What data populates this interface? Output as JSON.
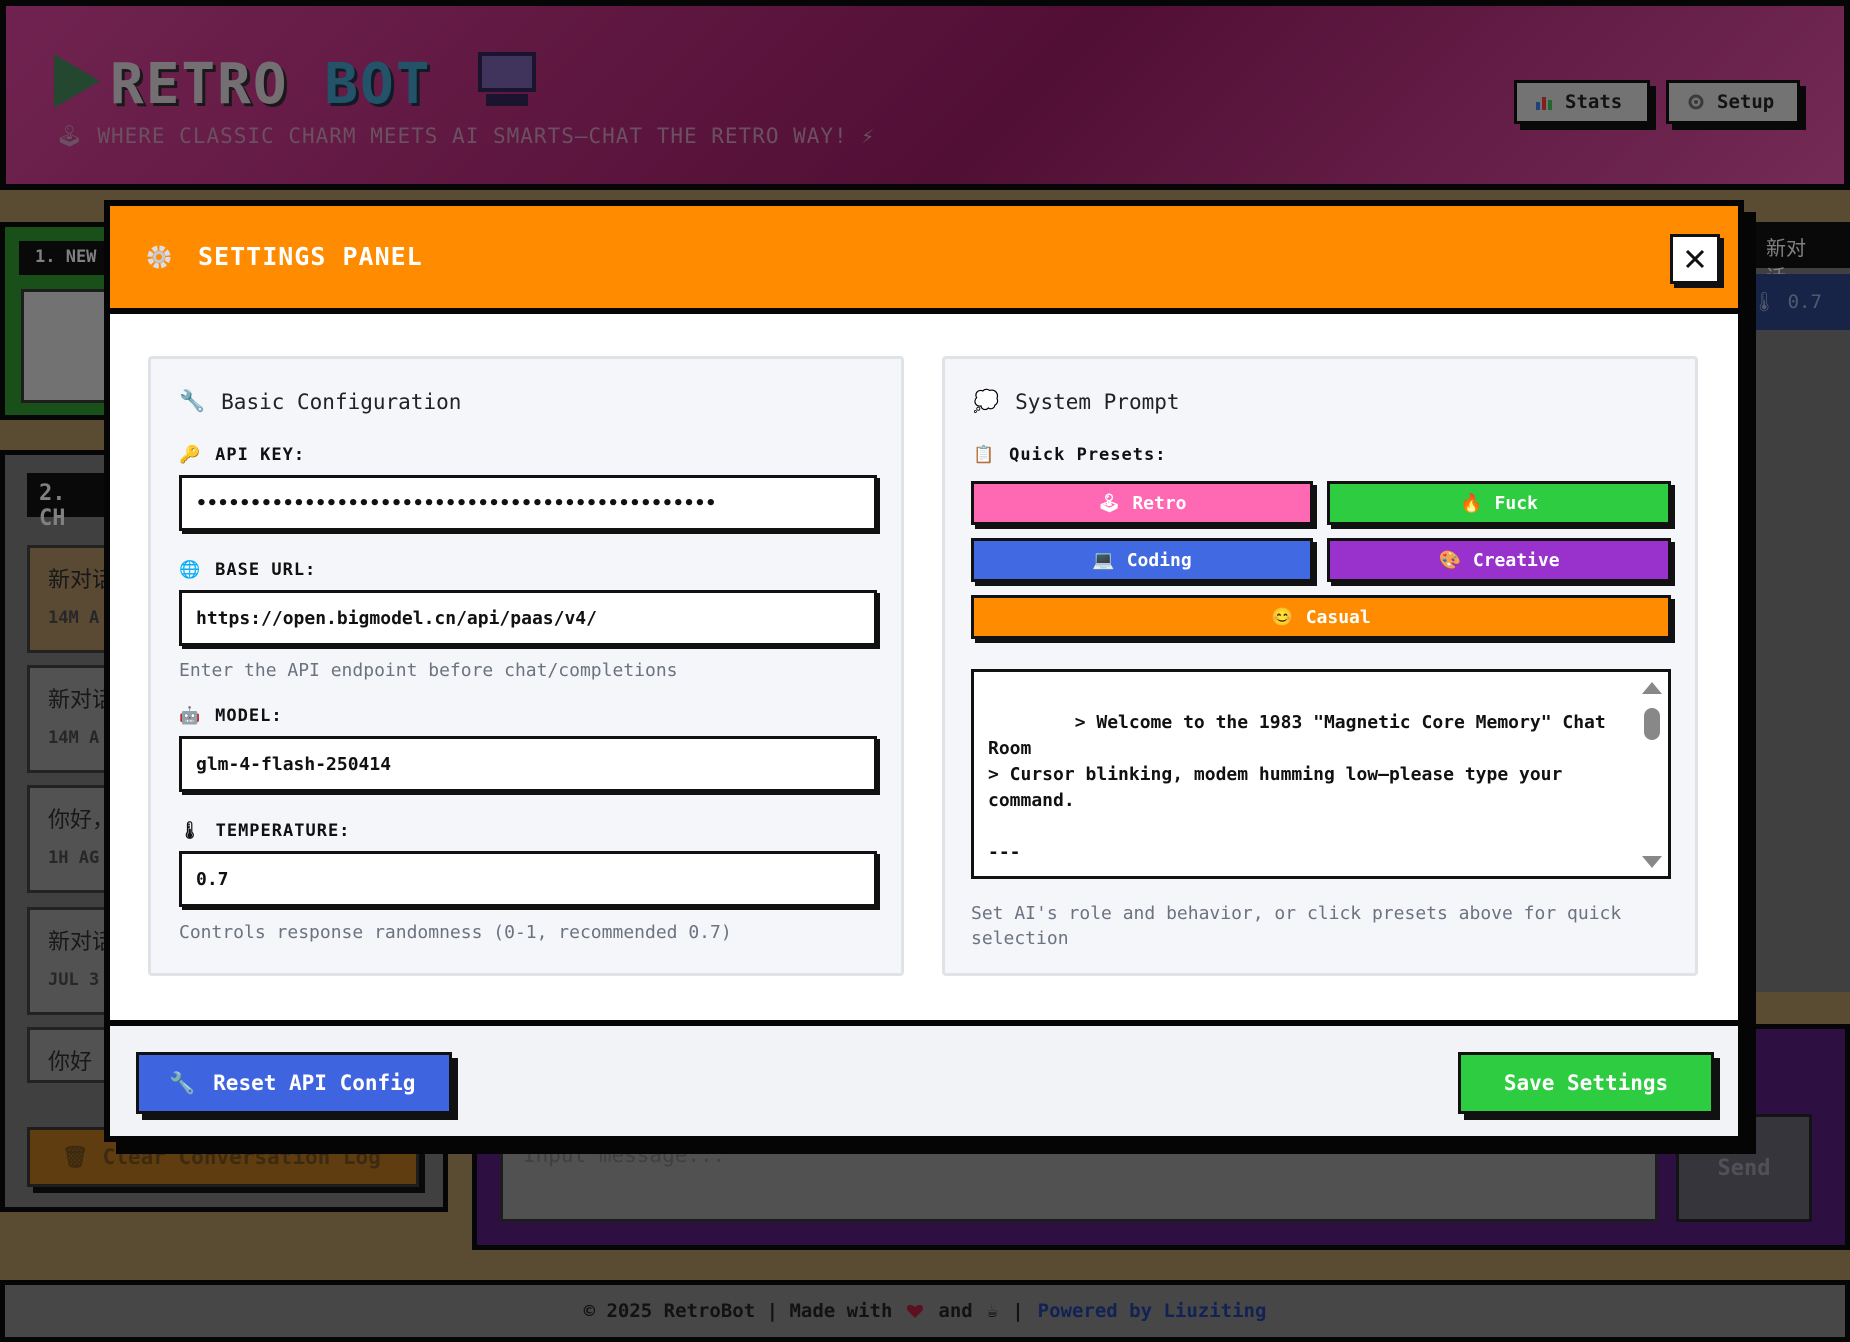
{
  "header": {
    "logo_retro": "RETRO",
    "logo_bot": "BOT",
    "tagline": "WHERE CLASSIC CHARM MEETS AI SMARTS—CHAT THE RETRO WAY!",
    "stats_label": "Stats",
    "setup_label": "Setup"
  },
  "sidebar": {
    "section1_title": "1. NEW",
    "section2_title": "2. CH",
    "conversations": [
      {
        "title": "新对话",
        "meta": "14M A"
      },
      {
        "title": "新对话",
        "meta": "14M A"
      },
      {
        "title": "你好，",
        "meta": "1H AG"
      },
      {
        "title": "新对话",
        "meta": "JUL 3"
      },
      {
        "title": "你好",
        "meta": ""
      }
    ],
    "clear_label": "Clear Conversation Log"
  },
  "right_panel": {
    "tab_title": "新对话",
    "temp_value": "0.7"
  },
  "chat": {
    "input_placeholder": "Input message...",
    "send_label": "Send"
  },
  "footer": {
    "copyright": "© 2025 RetroBot | Made with",
    "and": "and",
    "separator": "|",
    "powered": "Powered by Liuziting"
  },
  "modal": {
    "title": "SETTINGS PANEL",
    "basic": {
      "title": "Basic Configuration",
      "api_key_label": "API KEY:",
      "api_key_value": "••••••••••••••••••••••••••••••••••••••••••••••••",
      "base_url_label": "BASE URL:",
      "base_url_value": "https://open.bigmodel.cn/api/paas/v4/",
      "base_url_hint": "Enter the API endpoint before chat/completions",
      "model_label": "MODEL:",
      "model_value": "glm-4-flash-250414",
      "temperature_label": "TEMPERATURE:",
      "temperature_value": "0.7",
      "temperature_hint": "Controls response randomness (0-1, recommended 0.7)"
    },
    "system": {
      "title": "System Prompt",
      "presets_label": "Quick Presets:",
      "presets": {
        "retro": "Retro",
        "fuck": "Fuck",
        "coding": "Coding",
        "creative": "Creative",
        "casual": "Casual"
      },
      "prompt_text": "> Welcome to the 1983 \"Magnetic Core Memory\" Chat Room\n> Cursor blinking, modem humming low—please type your command.\n\n---\n\n## Character Setting",
      "hint": "Set AI's role and behavior, or click presets above for quick selection"
    },
    "reset_label": "Reset API Config",
    "save_label": "Save Settings"
  },
  "colors": {
    "header_accent": "#ff8c00",
    "reset_button": "#3f64e0",
    "save_button": "#2ecc40",
    "preset_retro": "#ff69b4",
    "preset_fuck": "#2ecc40",
    "preset_coding": "#4169e1",
    "preset_creative": "#9932cc",
    "preset_casual": "#ff8c00"
  }
}
